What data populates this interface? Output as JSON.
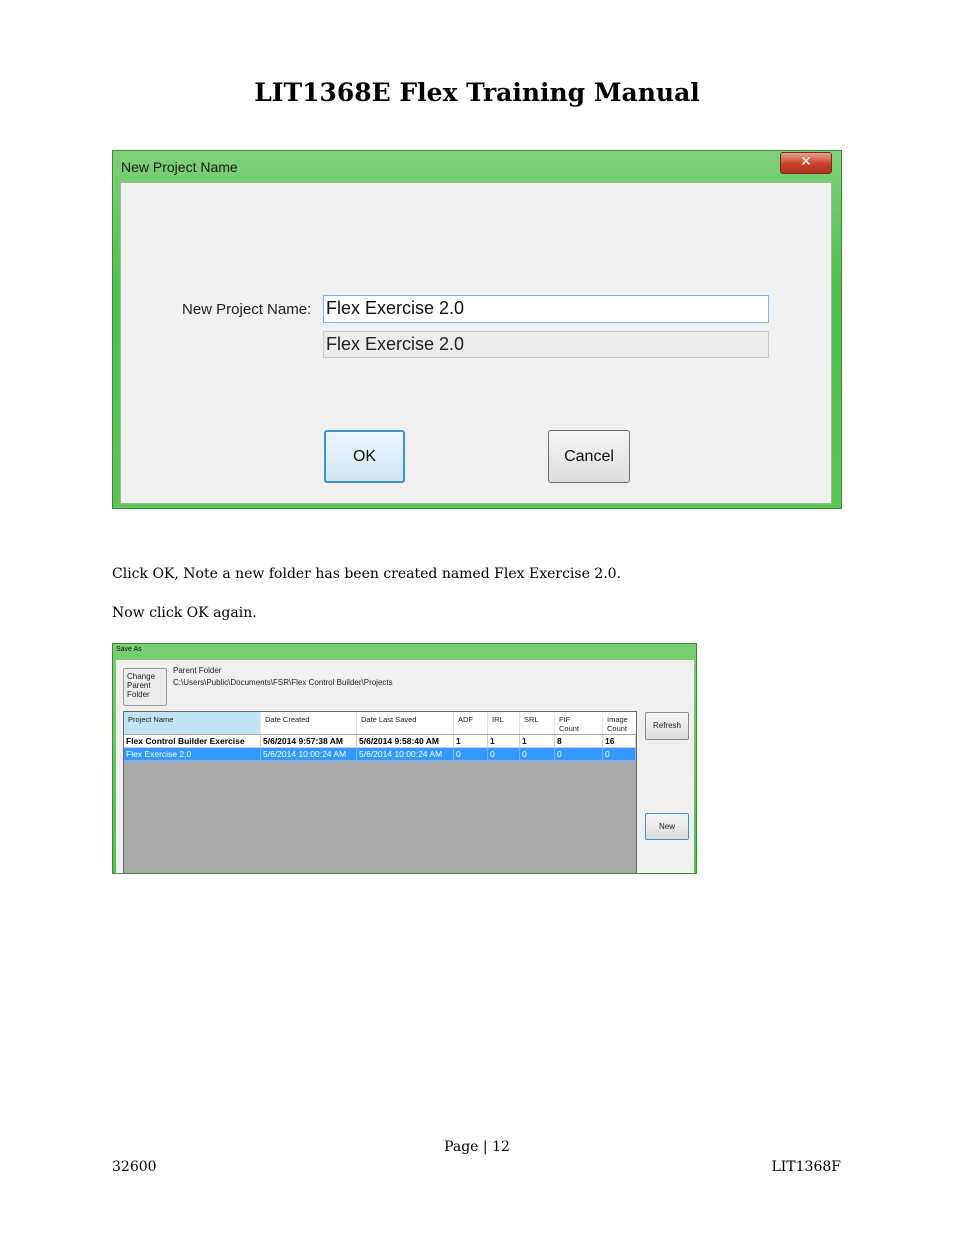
{
  "document": {
    "title": "LIT1368E Flex Training Manual",
    "para1": "Click OK, Note a new folder has been created named Flex Exercise 2.0.",
    "para2": "Now click OK again.",
    "page": "Page | 12",
    "footer_left": "32600",
    "footer_right": "LIT1368F"
  },
  "dialog1": {
    "title": "New Project Name",
    "close": "✕",
    "label": "New Project Name:",
    "input_value": "Flex Exercise 2.0",
    "readonly_value": "Flex Exercise 2.0",
    "ok": "OK",
    "cancel": "Cancel"
  },
  "dialog2": {
    "title": "Save As",
    "change_parent_folder": [
      "Change",
      "Parent",
      "Folder"
    ],
    "parent_folder_label": "Parent Folder",
    "parent_folder_path": "C:\\Users\\Public\\Documents\\FSR\\Flex Control Builder\\Projects",
    "columns": [
      "Project Name",
      "Date Created",
      "Date Last Saved",
      "ADF",
      "IRL",
      "SRL",
      "FIF Count",
      "Image Count"
    ],
    "rows": [
      [
        "Flex Control Builder Exercise",
        "5/6/2014 9:57:38 AM",
        "5/6/2014 9:58:40 AM",
        "1",
        "1",
        "1",
        "8",
        "16"
      ],
      [
        "Flex Exercise 2.0",
        "5/6/2014 10:00:24 AM",
        "5/6/2014 10:00:24 AM",
        "0",
        "0",
        "0",
        "0",
        "0"
      ]
    ],
    "refresh": "Refresh",
    "new": "New"
  }
}
